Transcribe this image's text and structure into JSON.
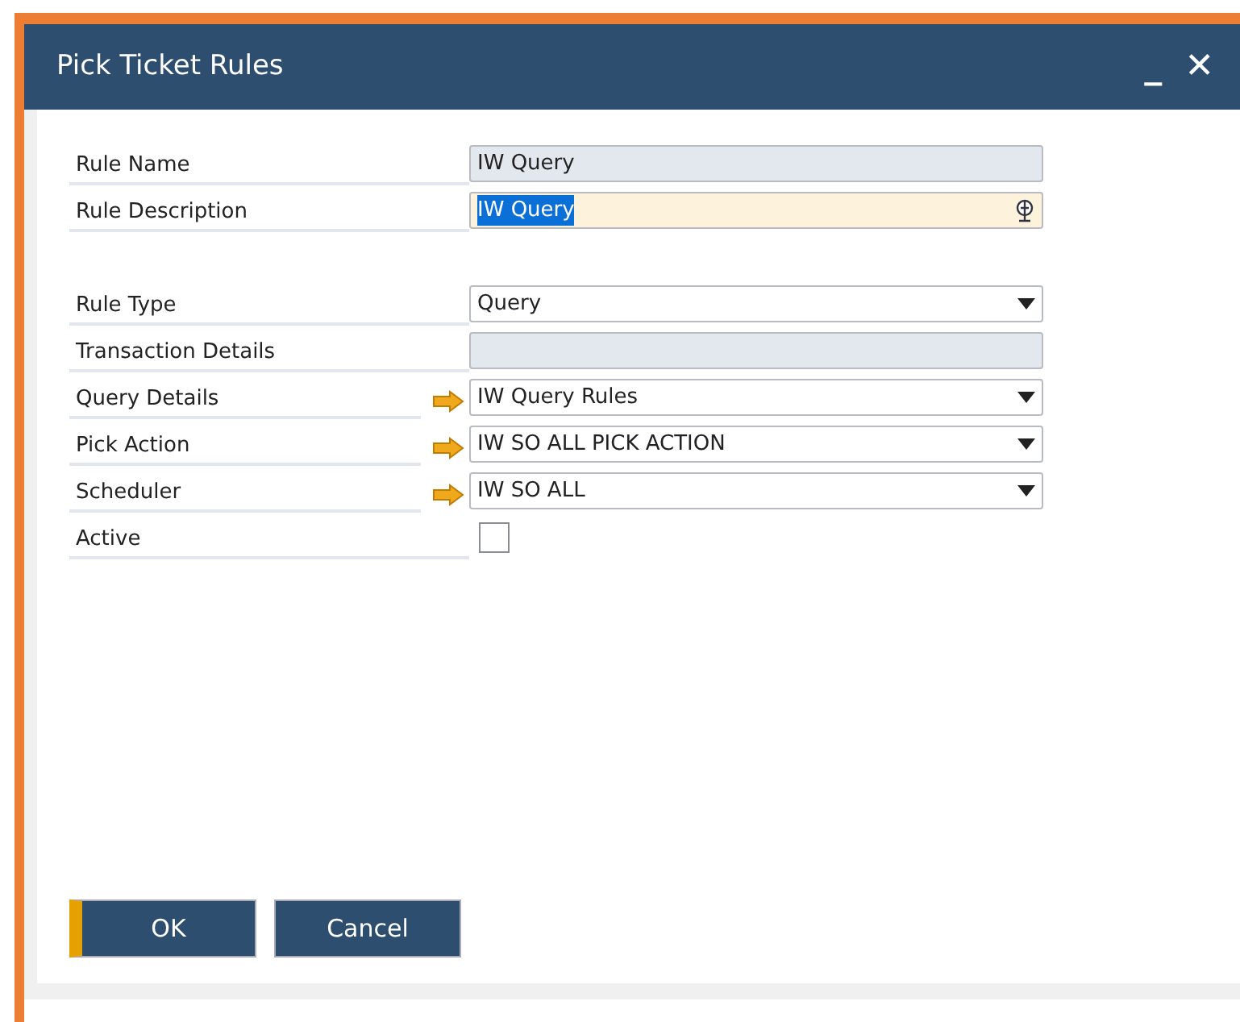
{
  "window": {
    "title": "Pick Ticket Rules",
    "controls": [
      "_",
      "✕"
    ]
  },
  "fields": [
    {
      "kind": "text",
      "label": "Rule Name",
      "value": "IW Query",
      "disabled": true,
      "focused": false,
      "link": false
    },
    {
      "kind": "text",
      "label": "Rule Description",
      "value": "IW Query",
      "disabled": false,
      "focused": true,
      "link": false,
      "translate": true
    },
    {
      "kind": "spacer"
    },
    {
      "kind": "dropdown",
      "label": "Rule Type",
      "value": "Query",
      "link": false
    },
    {
      "kind": "text",
      "label": "Transaction Details",
      "disabled": true,
      "focused": false,
      "link": false
    },
    {
      "kind": "dropdown",
      "label": "Query Details",
      "value": "IW Query Rules",
      "link": true
    },
    {
      "kind": "dropdown",
      "label": "Pick Action",
      "value": "IW SO ALL PICK ACTION",
      "link": true
    },
    {
      "kind": "dropdown",
      "label": "Scheduler",
      "value": "IW SO ALL",
      "link": true
    },
    {
      "kind": "checkbox",
      "label": "Active",
      "checked": false
    }
  ],
  "buttons": [
    {
      "label": "OK",
      "default": true
    },
    {
      "label": "Cancel",
      "default": false
    }
  ]
}
